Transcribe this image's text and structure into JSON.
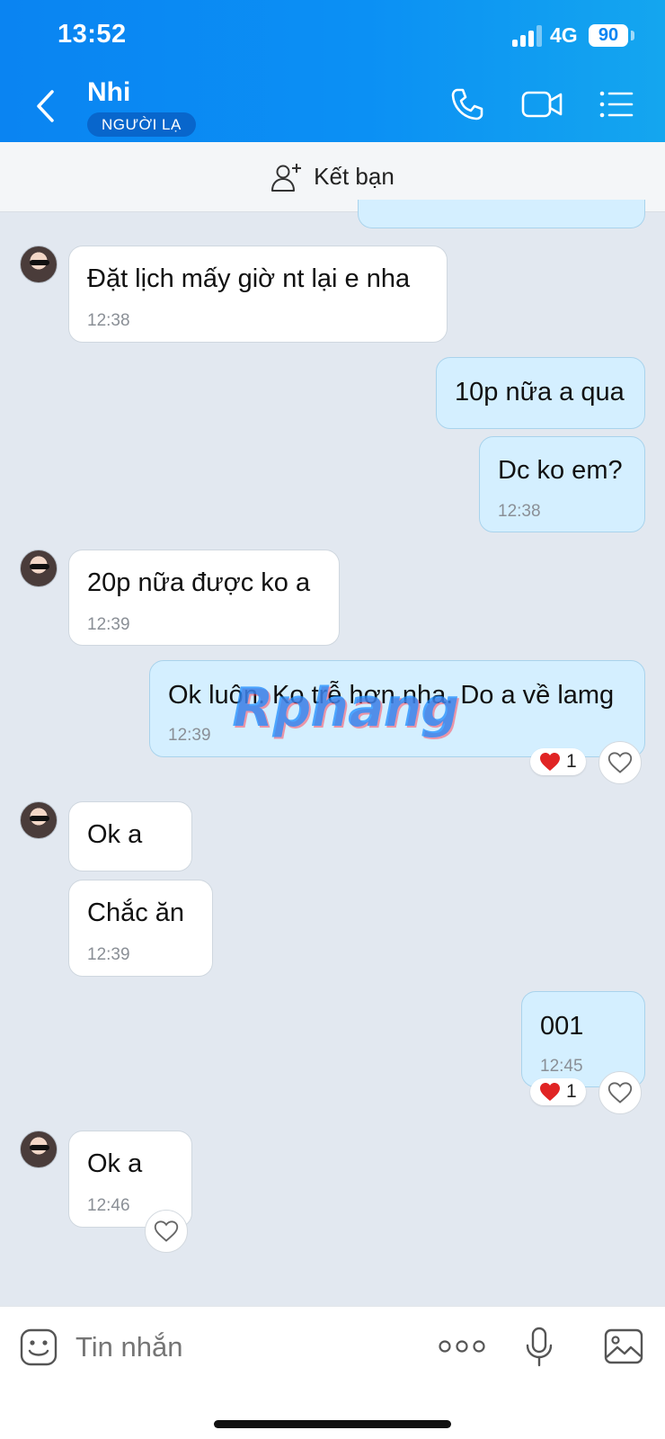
{
  "status_bar": {
    "time": "13:52",
    "network": "4G",
    "battery": "90"
  },
  "header": {
    "contact_name": "Nhi",
    "badge": "NGƯỜI LẠ",
    "icons": [
      "back-icon",
      "phone-icon",
      "video-call-icon",
      "menu-list-icon"
    ]
  },
  "friend_bar": {
    "label": "Kết bạn",
    "icon": "add-friend-icon"
  },
  "messages": [
    {
      "side": "in",
      "text": "Đặt lịch mấy giờ nt lại e nha",
      "time": "12:38"
    },
    {
      "side": "out",
      "text": "10p nữa a qua",
      "time": ""
    },
    {
      "side": "out",
      "text": "Dc ko em?",
      "time": "12:38"
    },
    {
      "side": "in",
      "text": "20p nữa được ko a",
      "time": "12:39"
    },
    {
      "side": "out",
      "text": "Ok luôn. Ko trễ hơn nha. Do a về lamg",
      "time": "12:39",
      "reaction_count": "1"
    },
    {
      "side": "in",
      "text": "Ok a",
      "time": ""
    },
    {
      "side": "in",
      "text": "Chắc ăn",
      "time": "12:39"
    },
    {
      "side": "out",
      "text": "001",
      "time": "12:45",
      "reaction_count": "1"
    },
    {
      "side": "in",
      "text": "Ok a",
      "time": "12:46"
    }
  ],
  "watermark": "Rphang",
  "input_bar": {
    "placeholder": "Tin nhắn"
  },
  "colors": {
    "header": "#0a84f2",
    "bubble_out": "#d4efff",
    "bubble_in": "#ffffff",
    "background": "#e2e8f0"
  }
}
